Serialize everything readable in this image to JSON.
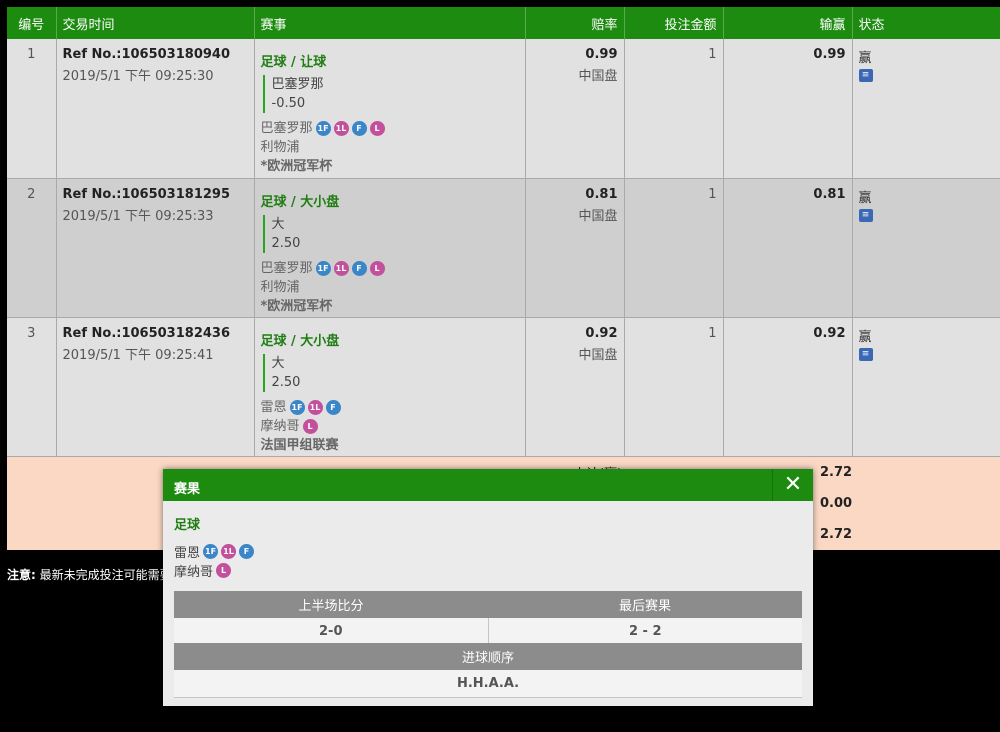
{
  "header": {
    "num": "编号",
    "time": "交易时间",
    "event": "赛事",
    "odds": "赔率",
    "stake": "投注金额",
    "winloss": "输赢",
    "status": "状态"
  },
  "bets": [
    {
      "num": "1",
      "ref": "Ref No.:106503180940",
      "time": "2019/5/1 下午 09:25:30",
      "sport": "足球 / 让球",
      "pick": "巴塞罗那",
      "line": "-0.50",
      "home": "巴塞罗那",
      "away": "利物浦",
      "league": "*欧洲冠军杯",
      "odds": "0.99",
      "market": "中国盘",
      "stake": "1",
      "winloss": "0.99",
      "status": "赢"
    },
    {
      "num": "2",
      "ref": "Ref No.:106503181295",
      "time": "2019/5/1 下午 09:25:33",
      "sport": "足球 / 大小盘",
      "pick": "大",
      "line": "2.50",
      "home": "巴塞罗那",
      "away": "利物浦",
      "league": "*欧洲冠军杯",
      "odds": "0.81",
      "market": "中国盘",
      "stake": "1",
      "winloss": "0.81",
      "status": "赢"
    },
    {
      "num": "3",
      "ref": "Ref No.:106503182436",
      "time": "2019/5/1 下午 09:25:41",
      "sport": "足球 / 大小盘",
      "pick": "大",
      "line": "2.50",
      "home": "雷恩",
      "away": "摩纳哥",
      "league": "法国甲组联赛",
      "odds": "0.92",
      "market": "中国盘",
      "stake": "1",
      "winloss": "0.92",
      "status": "赢"
    }
  ],
  "badges": {
    "b1f": "1F",
    "b1l": "1L",
    "bf": "F",
    "bl": "L"
  },
  "status_icon": "receipt-icon",
  "summary": {
    "label_partial": "小计(赢)",
    "total1": "2.72",
    "total2": "0.00",
    "total3": "2.72"
  },
  "note": {
    "bold": "注意:",
    "text": "最新未完成投注可能需要"
  },
  "modal": {
    "title": "赛果",
    "close": "✕",
    "sport": "足球",
    "home": "雷恩",
    "away": "摩纳哥",
    "ht_header": "上半场比分",
    "ft_header": "最后赛果",
    "ht_score": "2-0",
    "ft_score": "2 - 2",
    "seq_header": "进球顺序",
    "seq_value": "H.H.A.A."
  }
}
